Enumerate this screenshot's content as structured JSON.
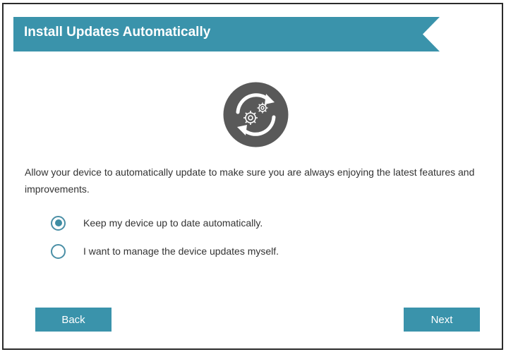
{
  "dialog": {
    "title": "Install Updates Automatically",
    "description": "Allow your device to automatically update to make sure you are always enjoying the latest features and improvements.",
    "options": [
      {
        "label": "Keep my device up to date automatically.",
        "selected": true
      },
      {
        "label": "I want to manage the device updates myself.",
        "selected": false
      }
    ],
    "back_label": "Back",
    "next_label": "Next"
  },
  "colors": {
    "accent": "#3a93ab",
    "icon_dark": "#595959",
    "text": "#333333"
  },
  "icons": {
    "update": "gear-refresh-icon"
  }
}
